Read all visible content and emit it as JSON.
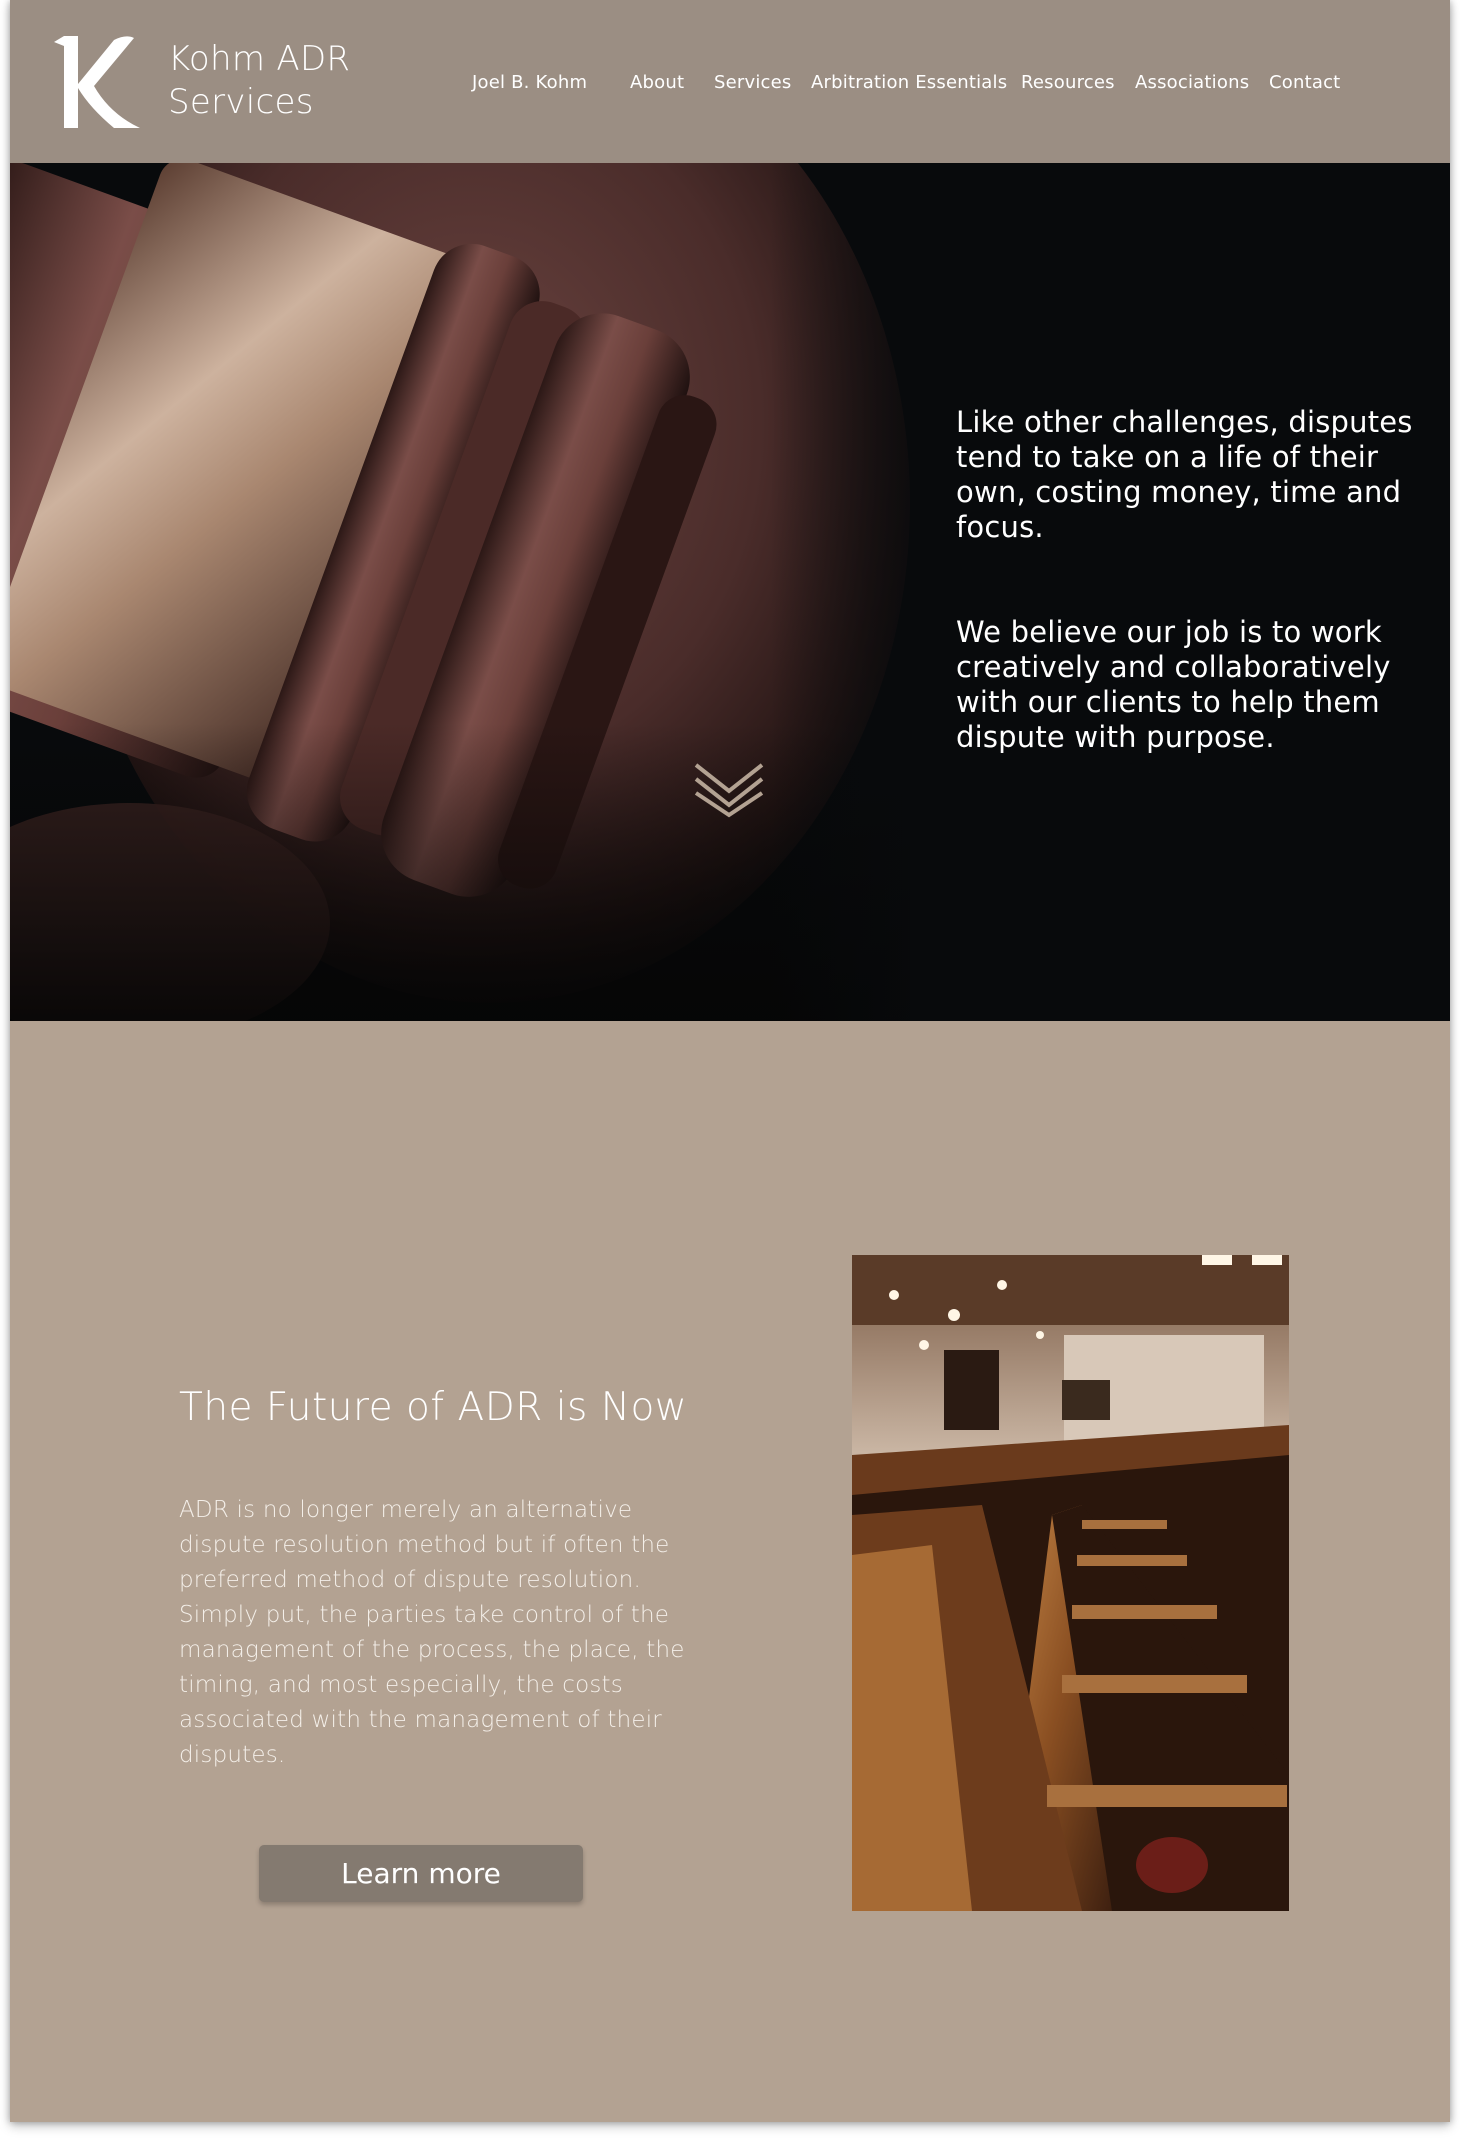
{
  "brand": {
    "line1": "Kohm ADR",
    "line2": "Services"
  },
  "nav": {
    "items": [
      {
        "label": "Joel B. Kohm"
      },
      {
        "label": "About"
      },
      {
        "label": "Services"
      },
      {
        "label": "Arbitration Essentials"
      },
      {
        "label": "Resources"
      },
      {
        "label": "Associations"
      },
      {
        "label": "Contact"
      }
    ]
  },
  "hero": {
    "paragraph1": "Like other challenges, disputes tend to take on a life of their own, costing money, time and focus.",
    "paragraph2": "We believe our job is to work creatively and collaboratively with our clients to help them dispute with purpose.",
    "scroll_icon": "double-chevron-down-icon"
  },
  "future": {
    "heading": "The Future of ADR is Now",
    "body": "ADR is no longer merely an alternative dispute resolution method but if often the preferred method of dispute resolution. Simply put, the parties take control of the management of the process, the place, the timing, and most especially, the costs associated with the management of their disputes.",
    "button_label": "Learn more"
  },
  "colors": {
    "header_bg": "#9b8e83",
    "section_bg": "#b3a292",
    "hero_bg": "#080a0c",
    "button_bg": "#847a70"
  }
}
